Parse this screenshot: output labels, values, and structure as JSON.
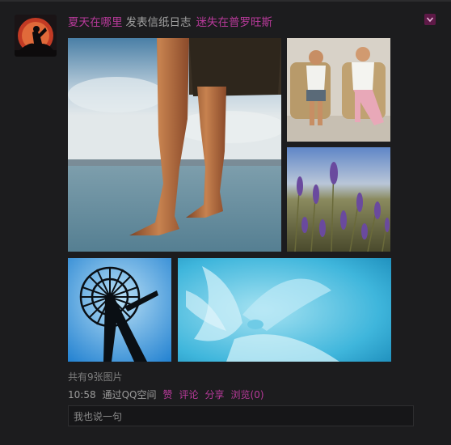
{
  "post": {
    "author": "夏天在哪里",
    "action": "发表信纸日志",
    "title": "迷失在普罗旺斯",
    "photo_count_text": "共有9张图片",
    "time": "10:58",
    "via": "通过QQ空间",
    "actions": [
      "赞",
      "评论",
      "分享"
    ],
    "views_label": "浏览(0)",
    "comment_placeholder": "我也说一句"
  },
  "icons": {
    "menu": "chevron-down-icon",
    "avatar": "samurai-silhouette-avatar"
  },
  "colors": {
    "background": "#1c1c1e",
    "accent": "#b83a9a",
    "menu_button": "#5e1947",
    "muted_text": "#8a8a8a"
  }
}
